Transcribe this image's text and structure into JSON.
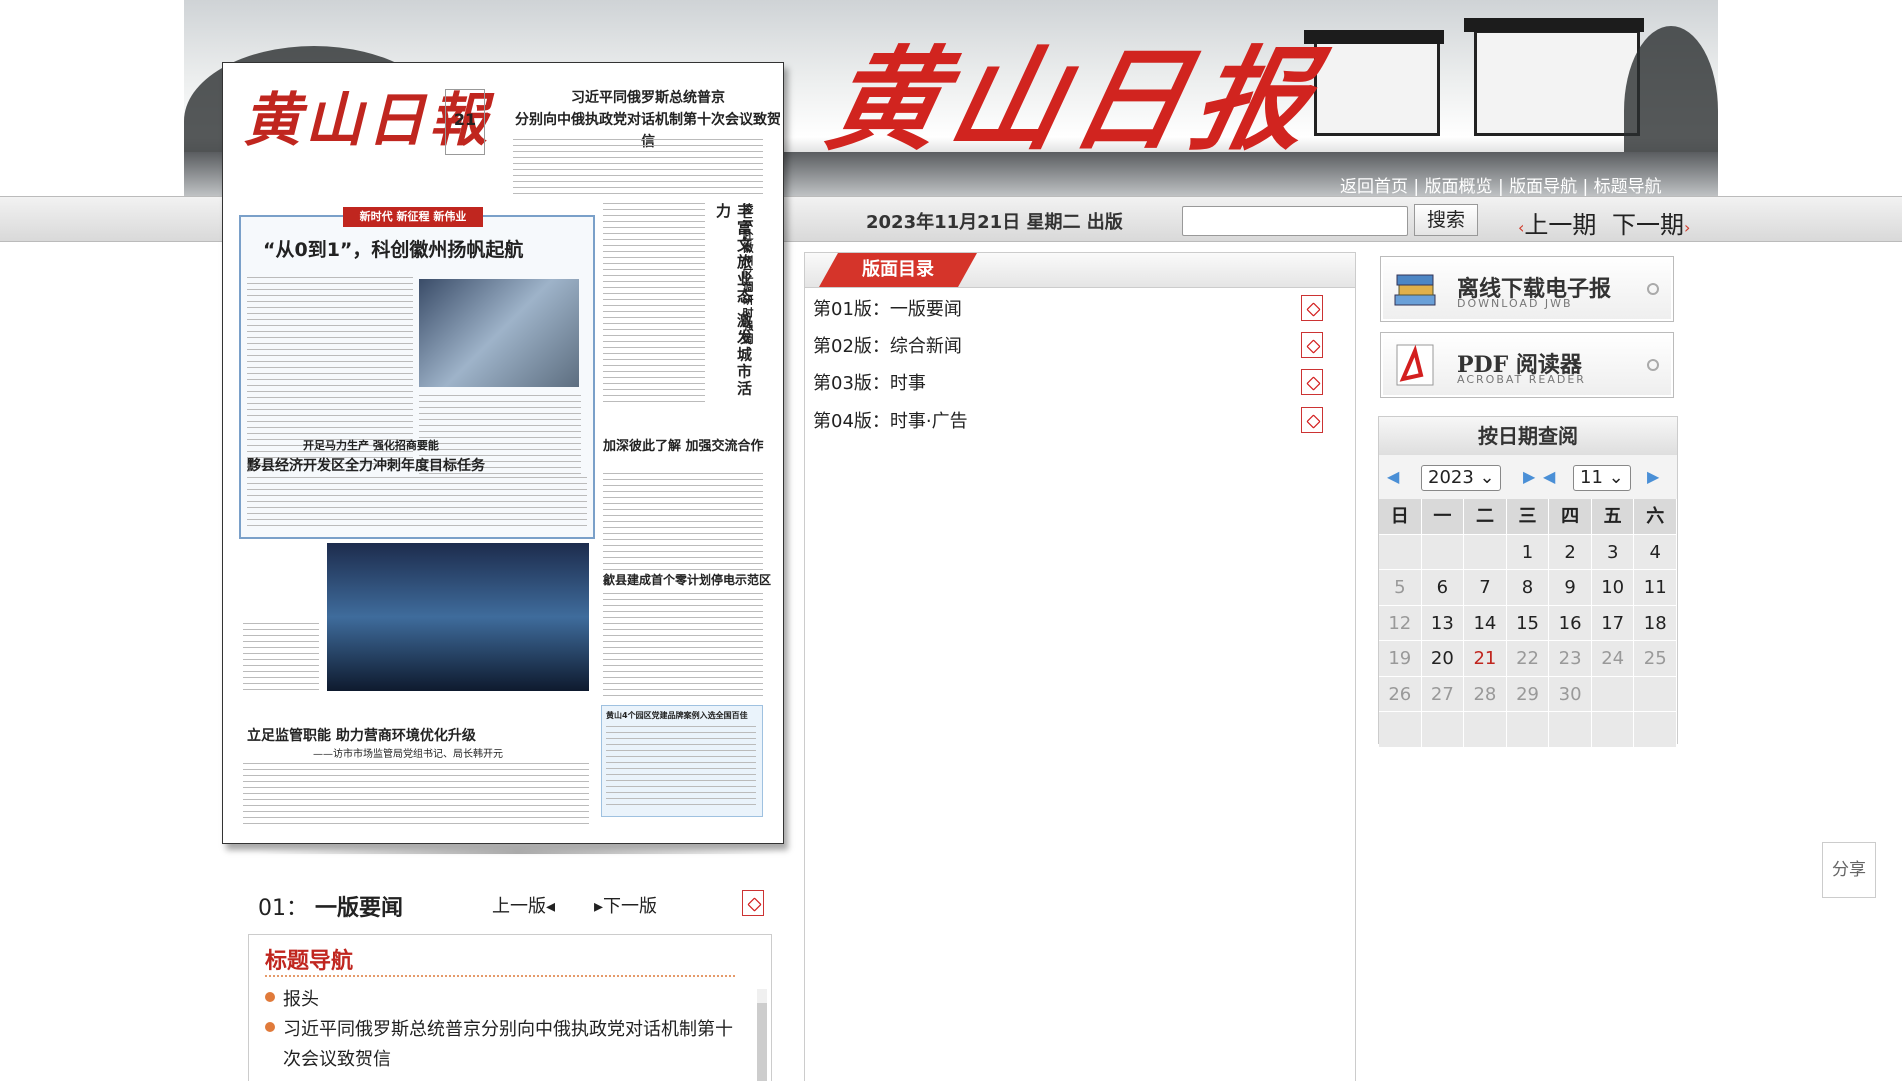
{
  "banner": {
    "logo_text": "黄山日报",
    "links": [
      "返回首页",
      "版面概览",
      "版面导航",
      "标题导航"
    ],
    "link_separator": " | "
  },
  "toolbar": {
    "date_text": "2023年11月21日 星期二 出版",
    "search_placeholder": "",
    "search_label": "搜索",
    "prev_issue": "上一期",
    "next_issue": "下一期"
  },
  "newspaper": {
    "masthead": "黄山日報",
    "day": "21",
    "top_headline_line1": "习近平同俄罗斯总统普京",
    "top_headline_line2": "分别向中俄执政党对话机制第十次会议致贺信",
    "red_banner": "新时代 新征程 新伟业",
    "main_title": "“从0到1”，科创徽州扬帆起航",
    "vertical_title": "丰富文旅业态 激发城市活力",
    "vertical_subtitle": "凌云赴徽州区调研时强调",
    "story2_kicker": "开足马力生产 强化招商要能",
    "story2_title": "黟县经济开发区全力冲刺年度目标任务",
    "story3_title": "加深彼此了解 加强交流合作",
    "story4_title": "歙县建成首个零计划停电示范区",
    "story5_title": "立足监管职能 助力营商环境优化升级",
    "story5_sub": "——访市市场监管局党组书记、局长韩开元",
    "bluebox_title": "黄山4个园区党建品牌案例入选全国百佳"
  },
  "page_info": {
    "number": "01",
    "separator": "：",
    "name": "一版要闻",
    "prev": "上一版",
    "next": "下一版"
  },
  "title_nav": {
    "heading": "标题导航",
    "items": [
      "报头",
      "习近平同俄罗斯总统普京分别向中俄执政党对话机制第十次会议致贺信"
    ]
  },
  "contents": {
    "heading": "版面目录",
    "pages": [
      {
        "label": "第01版：一版要闻"
      },
      {
        "label": "第02版：综合新闻"
      },
      {
        "label": "第03版：时事"
      },
      {
        "label": "第04版：时事·广告"
      }
    ]
  },
  "widgets": {
    "download": {
      "title": "离线下载电子报",
      "subtitle": "DOWNLOAD JWB"
    },
    "pdf": {
      "title": "PDF 阅读器",
      "subtitle": "ACROBAT READER"
    }
  },
  "calendar": {
    "title": "按日期查阅",
    "year": "2023",
    "month": "11",
    "weekdays": [
      "日",
      "一",
      "二",
      "三",
      "四",
      "五",
      "六"
    ],
    "weeks": [
      [
        "",
        "",
        "",
        "1",
        "2",
        "3",
        "4"
      ],
      [
        "5",
        "6",
        "7",
        "8",
        "9",
        "10",
        "11"
      ],
      [
        "12",
        "13",
        "14",
        "15",
        "16",
        "17",
        "18"
      ],
      [
        "19",
        "20",
        "21",
        "22",
        "23",
        "24",
        "25"
      ],
      [
        "26",
        "27",
        "28",
        "29",
        "30",
        "",
        ""
      ],
      [
        "",
        "",
        "",
        "",
        "",
        "",
        ""
      ]
    ],
    "dim_days": [
      "5",
      "12",
      "19",
      "22",
      "23",
      "24",
      "25",
      "26",
      "27",
      "28",
      "29",
      "30"
    ],
    "today": "21",
    "colors": {
      "today": "#c0261f",
      "dim": "#999999"
    }
  },
  "share": {
    "label": "分享"
  },
  "colors": {
    "brand_red": "#c0261f",
    "link_arrow": "#4a8fd6"
  },
  "icons": {
    "pdf": "pdf-icon",
    "books": "books-icon",
    "acrobat": "acrobat-icon"
  }
}
